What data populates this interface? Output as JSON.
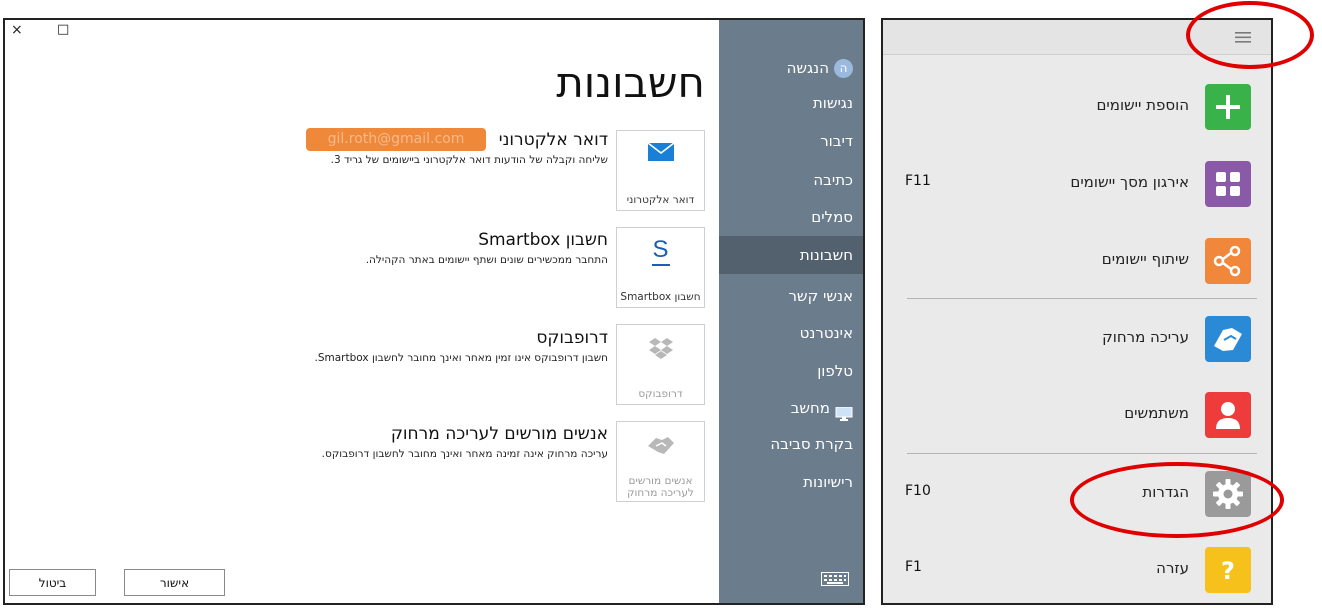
{
  "settings_window": {
    "controls": {
      "close_glyph": "×",
      "maximize_glyph": "□"
    },
    "title": "חשבונות",
    "sidebar": {
      "items": [
        {
          "label": "הנגשה",
          "avatar": "ה"
        },
        {
          "label": "נגישות"
        },
        {
          "label": "דיבור"
        },
        {
          "label": "כתיבה"
        },
        {
          "label": "סמלים"
        },
        {
          "label": "חשבונות",
          "selected": true
        },
        {
          "label": "אנשי קשר"
        },
        {
          "label": "אינטרנט"
        },
        {
          "label": "טלפון"
        },
        {
          "label": "מחשב",
          "icon": "monitor-icon"
        },
        {
          "label": "בקרת סביבה"
        },
        {
          "label": "רישיונות"
        }
      ],
      "keyboard_icon": "keyboard-icon"
    },
    "accounts": [
      {
        "tile_label": "דואר אלקטרוני",
        "icon": "envelope-icon",
        "title": "דואר אלקטרוני",
        "value": "gil.roth@gmail.com",
        "description": "שליחה וקבלה של הודעות דואר אלקטרוני ביישומים של גריד 3."
      },
      {
        "tile_label": "חשבון Smartbox",
        "icon": "smartbox-s-icon",
        "icon_text": "S",
        "title": "חשבון Smartbox",
        "description": "התחבר ממכשירים שונים ושתף יישומים באתר הקהילה."
      },
      {
        "tile_label": "דרופבוקס",
        "icon": "dropbox-icon",
        "title": "דרופבוקס",
        "description": "חשבון דרופבוקס אינו זמין מאחר ואינך מחובר לחשבון Smartbox."
      },
      {
        "tile_label": "אנשים מורשים לעריכה מרחוק",
        "icon": "handshake-icon",
        "title": "אנשים מורשים לעריכה מרחוק",
        "description": "עריכה מרחוק אינה זמינה מאחר ואינך מחובר לחשבון דרופבוקס."
      }
    ],
    "buttons": {
      "ok": "אישור",
      "cancel": "ביטול"
    }
  },
  "app_menu": {
    "menu_icon": "hamburger-icon",
    "items": [
      {
        "label": "הוספת יישומים",
        "icon": "plus-icon",
        "color": "#39b24a",
        "shortcut": ""
      },
      {
        "label": "אירגון מסך יישומים",
        "icon": "grid-icon",
        "color": "#8a5aa8",
        "shortcut": "F11"
      },
      {
        "label": "שיתוף יישומים",
        "icon": "share-icon",
        "color": "#f0873a",
        "shortcut": ""
      },
      {
        "label": "עריכה מרחוק",
        "icon": "handshake-icon",
        "color": "#2a8ad6",
        "shortcut": ""
      },
      {
        "label": "משתמשים",
        "icon": "user-icon",
        "color": "#ee3b3b",
        "shortcut": ""
      },
      {
        "label": "הגדרות",
        "icon": "gear-icon",
        "color": "#9a9a9a",
        "shortcut": "F10"
      },
      {
        "label": "עזרה",
        "icon": "question-icon",
        "color": "#f5c11a",
        "shortcut": "F1"
      }
    ]
  },
  "colors": {
    "sidebar": "#6b7c8c",
    "sidebar_selected": "#53616e",
    "annotation": "#e00000",
    "email_highlight": "#f0883a"
  }
}
